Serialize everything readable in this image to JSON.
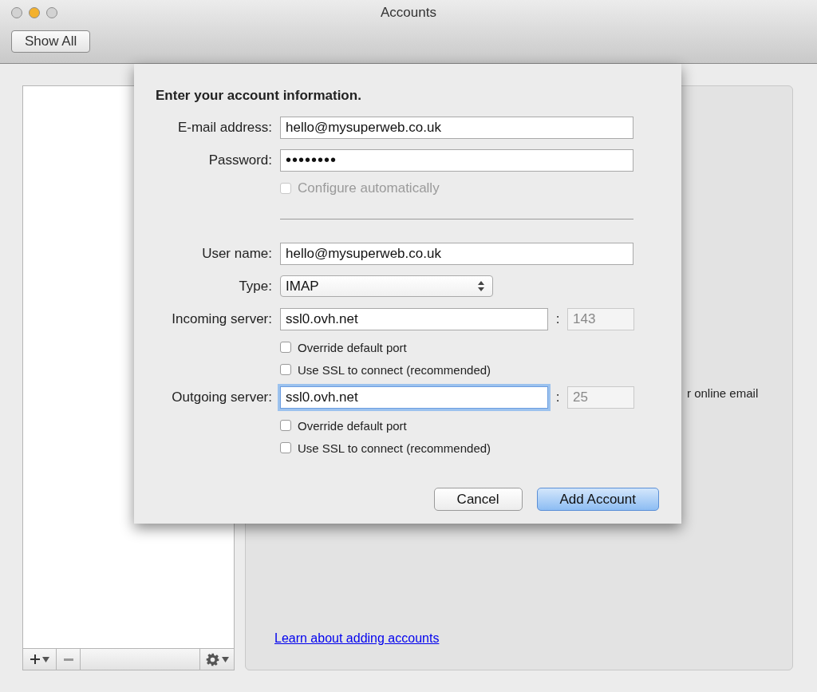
{
  "window": {
    "title": "Accounts",
    "toolbar_button": "Show All"
  },
  "panel": {
    "overlapped_text": "r online email",
    "link": "Learn about adding accounts"
  },
  "sheet": {
    "heading": "Enter your account information.",
    "fields": [
      {
        "kind": "text",
        "label": "E-mail address:",
        "value": "hello@mysuperweb.co.uk"
      },
      {
        "kind": "text",
        "label": "Password:",
        "value": "••••••••"
      },
      {
        "kind": "check",
        "label": "Configure automatically",
        "checked": false,
        "disabled": true
      },
      {
        "kind": "divider"
      },
      {
        "kind": "text",
        "label": "User name:",
        "value": "hello@mysuperweb.co.uk"
      },
      {
        "kind": "select",
        "label": "Type:",
        "value": "IMAP"
      },
      {
        "kind": "server",
        "label": "Incoming server:",
        "value": "ssl0.ovh.net",
        "separator": ":",
        "port_placeholder": "143",
        "focused": false
      },
      {
        "kind": "check",
        "label": "Override default port",
        "checked": false,
        "disabled": false
      },
      {
        "kind": "check",
        "label": "Use SSL to connect (recommended)",
        "checked": false,
        "disabled": false
      },
      {
        "kind": "server",
        "label": "Outgoing server:",
        "value": "ssl0.ovh.net",
        "separator": ":",
        "port_placeholder": "25",
        "focused": true
      },
      {
        "kind": "check",
        "label": "Override default port",
        "checked": false,
        "disabled": false
      },
      {
        "kind": "check",
        "label": "Use SSL to connect (recommended)",
        "checked": false,
        "disabled": false
      }
    ],
    "buttons": [
      {
        "label": "Cancel",
        "default": false
      },
      {
        "label": "Add Account",
        "default": true
      }
    ]
  }
}
